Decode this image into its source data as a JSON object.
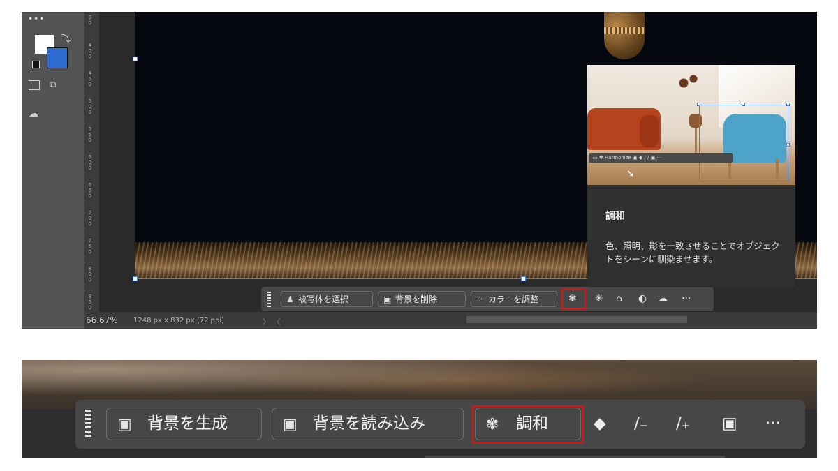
{
  "top": {
    "ruler_ticks": [
      "3\n0",
      "4\n0",
      "4\n5",
      "5\n0",
      "5\n5",
      "6\n0",
      "6\n5",
      "7\n0",
      "7\n5",
      "8\n0",
      "8\n5"
    ],
    "statusbar": {
      "zoom": "66.67%",
      "doc_size": "1248 px x 832 px (72 ppi)",
      "nav": "〉 〈"
    },
    "taskbar": {
      "select_subject": "被写体を選択",
      "remove_background": "背景を削除",
      "adjust_color": "カラーを調整",
      "more": "···"
    },
    "tooltip": {
      "title": "調和",
      "description": "色、照明、影を一致させることでオブジェクトをシーンに馴染ませます。",
      "mini_bar_label": "Harmonize"
    }
  },
  "bottom": {
    "taskbar": {
      "generate_background": "背景を生成",
      "import_background": "背景を読み込み",
      "harmonize": "調和",
      "more": "···"
    }
  },
  "icons": {
    "select_subject": "person-icon",
    "remove_background": "image-icon",
    "adjust_color": "color-adjust-icon",
    "harmonize": "harmonize-icon",
    "generate_background": "image-sparkle-icon",
    "import_background": "image-import-icon",
    "fill": "paint-bucket-icon",
    "brush_minus": "brush-minus-icon",
    "brush_plus": "brush-plus-icon",
    "mask": "mask-icon"
  },
  "colors": {
    "highlight": "#e01010",
    "background_swatch": "#2d6bd3",
    "foreground_swatch": "#ffffff",
    "guide": "#4a7fd8"
  }
}
